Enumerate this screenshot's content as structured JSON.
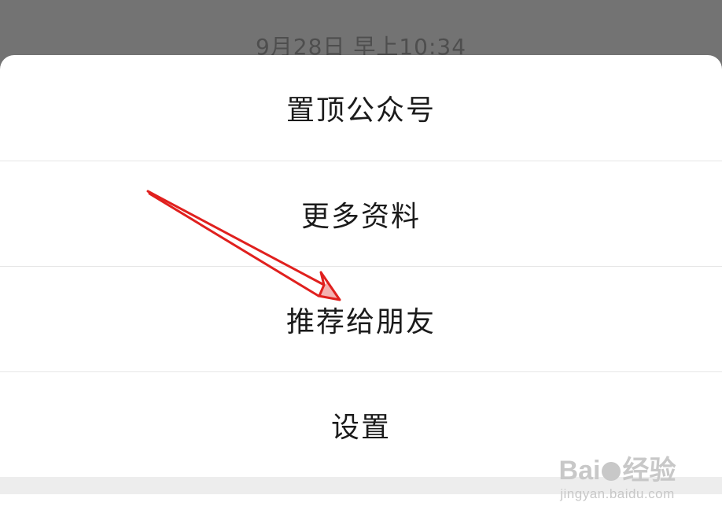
{
  "background": {
    "timestamp": "9月28日 早上10:34"
  },
  "menu": {
    "items": [
      {
        "key": "pin",
        "label": "置顶公众号"
      },
      {
        "key": "more-info",
        "label": "更多资料"
      },
      {
        "key": "recommend",
        "label": "推荐给朋友"
      },
      {
        "key": "settings",
        "label": "设置"
      }
    ]
  },
  "annotation": {
    "arrow_color": "#e0201e",
    "points_to": "推荐给朋友"
  },
  "watermark": {
    "logo_text_left": "Bai",
    "logo_text_right": "经验",
    "url": "jingyan.baidu.com"
  }
}
